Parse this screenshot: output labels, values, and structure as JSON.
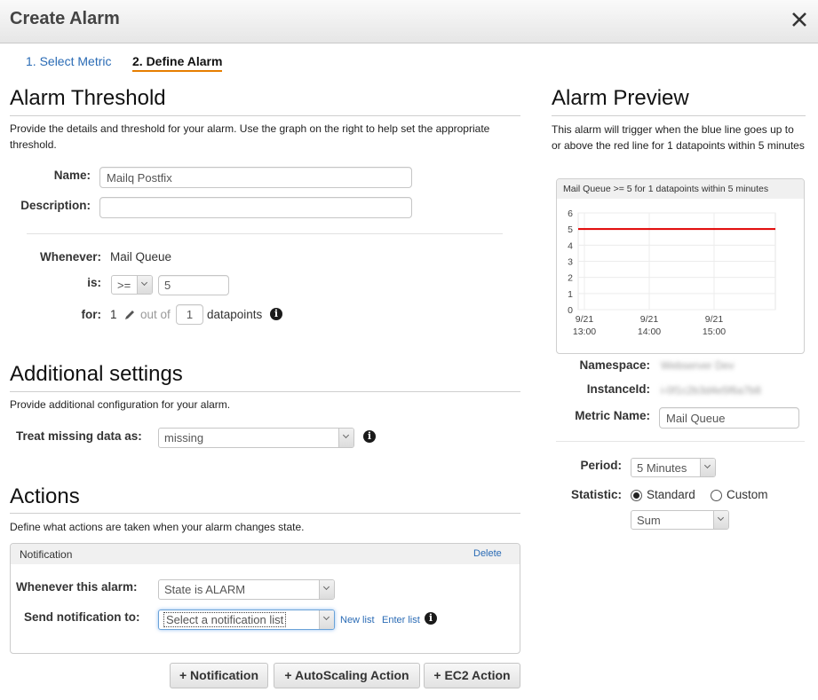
{
  "dialog": {
    "title": "Create Alarm",
    "close_icon": "close-icon"
  },
  "steps": [
    {
      "label": "1. Select Metric",
      "active": false
    },
    {
      "label": "2. Define Alarm",
      "active": true
    }
  ],
  "threshold": {
    "heading": "Alarm Threshold",
    "description": "Provide the details and threshold for your alarm. Use the graph on the right to help set the appropriate threshold.",
    "name_label": "Name:",
    "name_value": "Mailq Postfix",
    "description_label": "Description:",
    "description_value": "",
    "whenever_label": "Whenever:",
    "whenever_value": "Mail Queue",
    "is_label": "is:",
    "operator_value": ">=",
    "threshold_value": "5",
    "for_label": "for:",
    "for_count": "1",
    "edit_icon": "pencil-icon",
    "out_of_text": "out of",
    "out_of_value": "1",
    "datapoints_text": "datapoints",
    "info_icon": "info-icon"
  },
  "additional": {
    "heading": "Additional settings",
    "description": "Provide additional configuration for your alarm.",
    "missing_label": "Treat missing data as:",
    "missing_value": "missing"
  },
  "actions": {
    "heading": "Actions",
    "description": "Define what actions are taken when your alarm changes state.",
    "notification": {
      "title": "Notification",
      "delete_label": "Delete",
      "whenever_label": "Whenever this alarm:",
      "whenever_value": "State is ALARM",
      "send_label": "Send notification to:",
      "send_value": "Select a notification list",
      "new_list_label": "New list",
      "enter_list_label": "Enter list"
    },
    "buttons": [
      {
        "label": "+ Notification"
      },
      {
        "label": "+ AutoScaling Action"
      },
      {
        "label": "+ EC2 Action"
      }
    ]
  },
  "preview": {
    "heading": "Alarm Preview",
    "description": "This alarm will trigger when the blue line goes up to or above the red line for 1 datapoints within 5 minutes",
    "namespace_label": "Namespace:",
    "namespace_value": "Webserver Dev",
    "instanceid_label": "InstanceId:",
    "instanceid_value": "i-0f1c2b3d4e5f6a7b8",
    "metric_label": "Metric Name:",
    "metric_value": "Mail Queue",
    "period_label": "Period:",
    "period_value": "5 Minutes",
    "statistic_label": "Statistic:",
    "statistic_options": [
      {
        "label": "Standard",
        "selected": true
      },
      {
        "label": "Custom",
        "selected": false
      }
    ],
    "statistic_value": "Sum"
  },
  "chart_data": {
    "type": "line",
    "title": "Mail Queue >= 5 for 1 datapoints within 5 minutes",
    "xlabel": "",
    "ylabel": "",
    "ylim": [
      0,
      6
    ],
    "yticks": [
      "0",
      "1",
      "2",
      "3",
      "4",
      "5",
      "6"
    ],
    "xticks": [
      {
        "date": "9/21",
        "time": "13:00"
      },
      {
        "date": "9/21",
        "time": "14:00"
      },
      {
        "date": "9/21",
        "time": "15:00"
      }
    ],
    "grid": true,
    "series": [
      {
        "name": "threshold",
        "color": "#e00000",
        "values": [
          5,
          5
        ]
      }
    ]
  }
}
